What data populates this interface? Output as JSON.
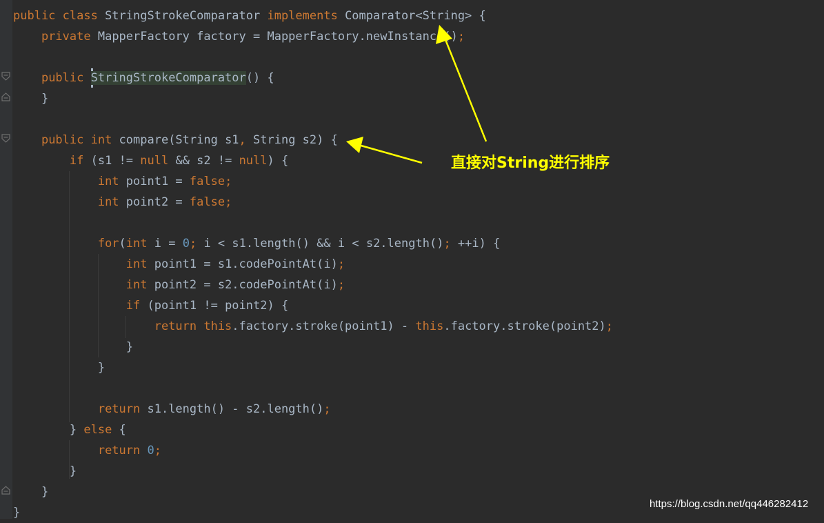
{
  "editor": {
    "lines": [
      [
        [
          "kw",
          "public class "
        ],
        [
          "id",
          "StringStrokeComparator "
        ],
        [
          "kw",
          "implements "
        ],
        [
          "id",
          "Comparator<String> {"
        ]
      ],
      [
        [
          "id",
          "    "
        ],
        [
          "kw",
          "private "
        ],
        [
          "id",
          "MapperFactory factory = MapperFactory.newInstance()"
        ],
        [
          "pn",
          ";"
        ]
      ],
      [],
      [
        [
          "id",
          "    "
        ],
        [
          "kw",
          "public "
        ],
        [
          "hl",
          "StringStrokeComparator"
        ],
        [
          "id",
          "() {"
        ]
      ],
      [
        [
          "id",
          "    }"
        ]
      ],
      [],
      [
        [
          "id",
          "    "
        ],
        [
          "kw",
          "public int "
        ],
        [
          "id",
          "compare(String s1"
        ],
        [
          "pn",
          ", "
        ],
        [
          "id",
          "String s2) {"
        ]
      ],
      [
        [
          "id",
          "        "
        ],
        [
          "kw",
          "if "
        ],
        [
          "id",
          "(s1 != "
        ],
        [
          "kw",
          "null "
        ],
        [
          "id",
          "&& s2 != "
        ],
        [
          "kw",
          "null"
        ],
        [
          "id",
          ") {"
        ]
      ],
      [
        [
          "id",
          "            "
        ],
        [
          "kw",
          "int "
        ],
        [
          "id",
          "point1 = "
        ],
        [
          "kw",
          "false"
        ],
        [
          "pn",
          ";"
        ]
      ],
      [
        [
          "id",
          "            "
        ],
        [
          "kw",
          "int "
        ],
        [
          "id",
          "point2 = "
        ],
        [
          "kw",
          "false"
        ],
        [
          "pn",
          ";"
        ]
      ],
      [],
      [
        [
          "id",
          "            "
        ],
        [
          "kw",
          "for"
        ],
        [
          "id",
          "("
        ],
        [
          "kw",
          "int "
        ],
        [
          "id",
          "i = "
        ],
        [
          "num",
          "0"
        ],
        [
          "pn",
          "; "
        ],
        [
          "id",
          "i < s1.length() && i < s2.length()"
        ],
        [
          "pn",
          "; "
        ],
        [
          "id",
          "++i) {"
        ]
      ],
      [
        [
          "id",
          "                "
        ],
        [
          "kw",
          "int "
        ],
        [
          "id",
          "point1 = s1.codePointAt(i)"
        ],
        [
          "pn",
          ";"
        ]
      ],
      [
        [
          "id",
          "                "
        ],
        [
          "kw",
          "int "
        ],
        [
          "id",
          "point2 = s2.codePointAt(i)"
        ],
        [
          "pn",
          ";"
        ]
      ],
      [
        [
          "id",
          "                "
        ],
        [
          "kw",
          "if "
        ],
        [
          "id",
          "(point1 != point2) {"
        ]
      ],
      [
        [
          "id",
          "                    "
        ],
        [
          "kw",
          "return this"
        ],
        [
          "id",
          ".factory.stroke(point1) - "
        ],
        [
          "kw",
          "this"
        ],
        [
          "id",
          ".factory.stroke(point2)"
        ],
        [
          "pn",
          ";"
        ]
      ],
      [
        [
          "id",
          "                }"
        ]
      ],
      [
        [
          "id",
          "            }"
        ]
      ],
      [],
      [
        [
          "id",
          "            "
        ],
        [
          "kw",
          "return "
        ],
        [
          "id",
          "s1.length() - s2.length()"
        ],
        [
          "pn",
          ";"
        ]
      ],
      [
        [
          "id",
          "        } "
        ],
        [
          "kw",
          "else "
        ],
        [
          "id",
          "{"
        ]
      ],
      [
        [
          "id",
          "            "
        ],
        [
          "kw",
          "return "
        ],
        [
          "num",
          "0"
        ],
        [
          "pn",
          ";"
        ]
      ],
      [
        [
          "id",
          "        }"
        ]
      ],
      [
        [
          "id",
          "    }"
        ]
      ],
      [
        [
          "id",
          "}"
        ]
      ]
    ]
  },
  "annotation": {
    "text": "直接对String进行排序",
    "color": "#ffff00"
  },
  "watermark": {
    "text": "https://blog.csdn.net/qq446282412"
  },
  "colors": {
    "background": "#2b2b2b",
    "keyword": "#cc7832",
    "identifier": "#a9b7c6",
    "number": "#6897bb"
  }
}
